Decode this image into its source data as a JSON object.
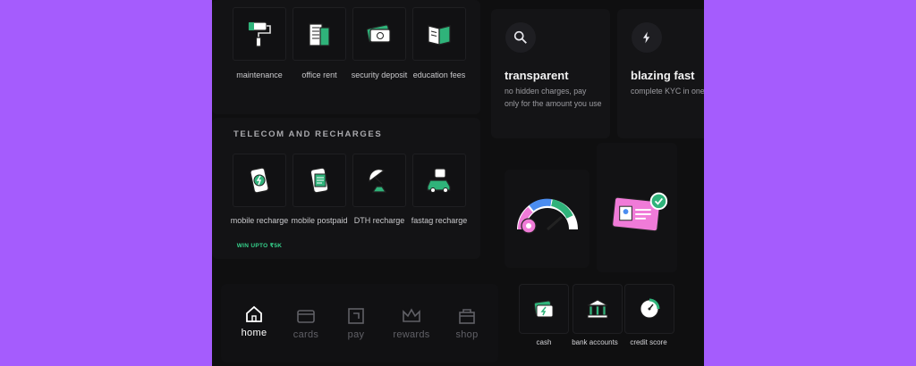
{
  "bills": [
    {
      "label": "maintenance",
      "icon": "paint-roller-icon"
    },
    {
      "label": "office rent",
      "icon": "office-building-icon"
    },
    {
      "label": "security deposit",
      "icon": "cash-bundle-icon"
    },
    {
      "label": "education fees",
      "icon": "book-icon"
    }
  ],
  "telecom": {
    "heading": "TELECOM AND RECHARGES",
    "items": [
      {
        "label": "mobile recharge",
        "badge": "WIN UPTO ₹5K",
        "icon": "mobile-bolt-icon"
      },
      {
        "label": "mobile postpaid",
        "icon": "mobile-bill-icon"
      },
      {
        "label": "DTH recharge",
        "icon": "satellite-dish-icon"
      },
      {
        "label": "fastag recharge",
        "icon": "fastag-car-icon"
      }
    ]
  },
  "features": [
    {
      "title": "transparent",
      "desc": "no hidden charges, pay only for the amount you use",
      "icon": "search-icon"
    },
    {
      "title": "blazing fast",
      "desc": "complete KYC in one tap, no documents, money instantly",
      "icon": "lightning-icon"
    }
  ],
  "illustrations": [
    {
      "icon": "speedometer-icon"
    },
    {
      "icon": "id-card-badge-icon"
    }
  ],
  "mini_tiles": [
    {
      "label": "cash",
      "icon": "cash-bolt-icon"
    },
    {
      "label": "bank accounts",
      "icon": "bank-icon"
    },
    {
      "label": "credit score",
      "icon": "credit-gauge-icon"
    }
  ],
  "nav": [
    {
      "label": "home",
      "icon": "home-icon",
      "active": true
    },
    {
      "label": "cards",
      "icon": "card-icon"
    },
    {
      "label": "pay",
      "icon": "pay-icon"
    },
    {
      "label": "rewards",
      "icon": "crown-icon"
    },
    {
      "label": "shop",
      "icon": "shop-bag-icon"
    }
  ],
  "colors": {
    "background": "#a55cfd",
    "accent_green": "#2fb37a",
    "badge_green": "#36d28c",
    "pink": "#f07bd8"
  }
}
